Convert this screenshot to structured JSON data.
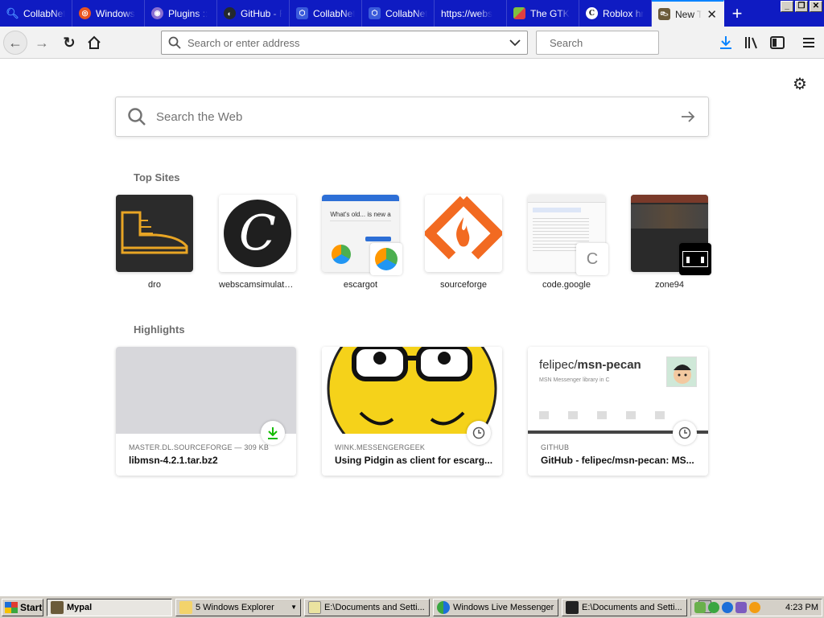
{
  "tabs": [
    {
      "label": "CollabNet",
      "favicon": "magnifier-icon",
      "color": "#2a6fe8"
    },
    {
      "label": "Windows",
      "favicon": "ubuntu-icon",
      "color": "#e95420"
    },
    {
      "label": "Plugins ::",
      "favicon": "pidgin-icon",
      "color": "#7c5cbf"
    },
    {
      "label": "GitHub - F",
      "favicon": "github-icon",
      "color": "#24292e"
    },
    {
      "label": "CollabNet",
      "favicon": "collabnet-icon",
      "color": "#2a6fe8"
    },
    {
      "label": "CollabNet",
      "favicon": "collabnet-icon",
      "color": "#2a6fe8"
    },
    {
      "label": "https://webs",
      "favicon": "",
      "color": ""
    },
    {
      "label": "The GTK",
      "favicon": "gtk-icon",
      "color": "#7fbf3f"
    },
    {
      "label": "Roblox hr",
      "favicon": "webscam-icon",
      "color": "#1a1a1a"
    }
  ],
  "active_tab": {
    "label": "New T",
    "favicon": "boot-icon"
  },
  "navbar": {
    "url_placeholder": "Search or enter address",
    "search_placeholder": "Search"
  },
  "content": {
    "websearch_placeholder": "Search the Web",
    "top_sites_title": "Top Sites",
    "highlights_title": "Highlights",
    "top_sites": [
      {
        "name": "dro"
      },
      {
        "name": "webscamsimulator..."
      },
      {
        "name": "escargot"
      },
      {
        "name": "sourceforge"
      },
      {
        "name": "code.google"
      },
      {
        "name": "zone94"
      }
    ],
    "escargot_text": "What's old... is new a",
    "highlights": [
      {
        "source": "MASTER.DL.SOURCEFORGE — 309 KB",
        "title": "libmsn-4.2.1.tar.bz2",
        "badge": "download-icon"
      },
      {
        "source": "WINK.MESSENGERGEEK",
        "title": "Using Pidgin as client for escarg...",
        "badge": "clock-icon"
      },
      {
        "source": "GITHUB",
        "title": "GitHub - felipec/msn-pecan: MS...",
        "badge": "clock-icon"
      }
    ],
    "github_card": {
      "user": "felipec/",
      "repo": "msn-pecan",
      "desc": "MSN Messenger library in C"
    }
  },
  "taskbar": {
    "start_label": "Start",
    "buttons": [
      {
        "label": "Mypal"
      },
      {
        "label": "5 Windows Explorer"
      },
      {
        "label": "E:\\Documents and Setti..."
      },
      {
        "label": "Windows Live Messenger"
      },
      {
        "label": "E:\\Documents and Setti..."
      }
    ],
    "clock": "4:23 PM"
  }
}
